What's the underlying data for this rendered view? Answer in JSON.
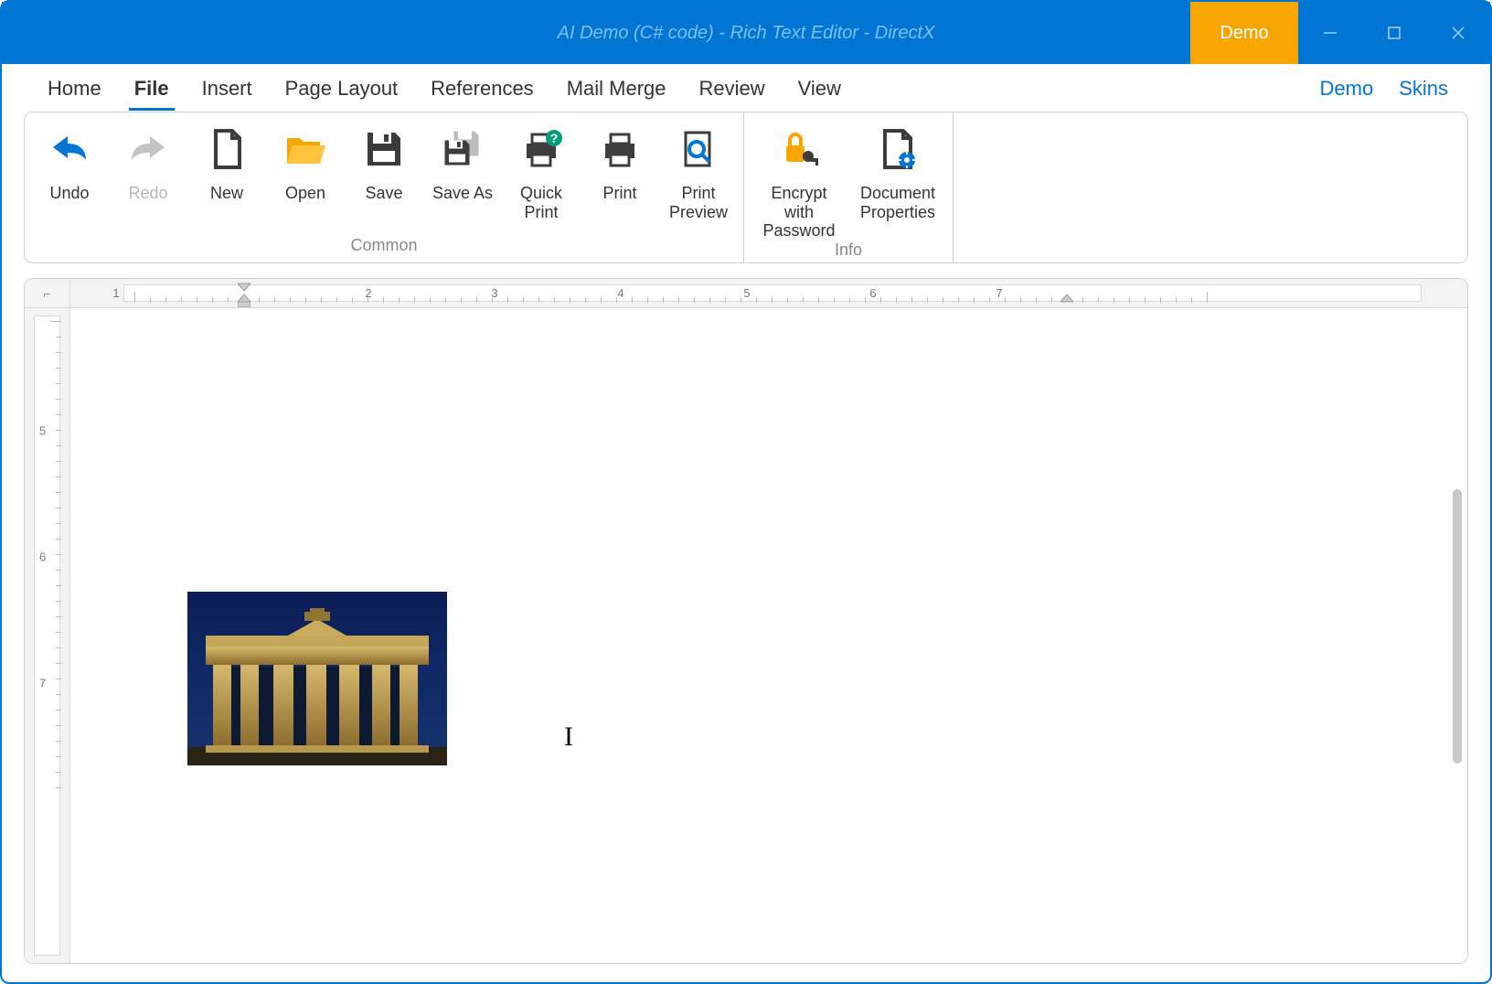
{
  "window": {
    "title": "AI Demo (C# code) - Rich Text Editor - DirectX",
    "demo_badge": "Demo"
  },
  "menu": {
    "tabs": [
      {
        "label": "Home",
        "active": false
      },
      {
        "label": "File",
        "active": true
      },
      {
        "label": "Insert",
        "active": false
      },
      {
        "label": "Page Layout",
        "active": false
      },
      {
        "label": "References",
        "active": false
      },
      {
        "label": "Mail Merge",
        "active": false
      },
      {
        "label": "Review",
        "active": false
      },
      {
        "label": "View",
        "active": false
      }
    ],
    "links": [
      {
        "label": "Demo"
      },
      {
        "label": "Skins"
      }
    ]
  },
  "ribbon": {
    "groups": [
      {
        "label": "Common",
        "items": [
          {
            "id": "undo",
            "label": "Undo",
            "icon": "undo-icon",
            "enabled": true
          },
          {
            "id": "redo",
            "label": "Redo",
            "icon": "redo-icon",
            "enabled": false
          },
          {
            "id": "new",
            "label": "New",
            "icon": "new-file-icon",
            "enabled": true
          },
          {
            "id": "open",
            "label": "Open",
            "icon": "open-folder-icon",
            "enabled": true
          },
          {
            "id": "save",
            "label": "Save",
            "icon": "save-icon",
            "enabled": true
          },
          {
            "id": "save-as",
            "label": "Save As",
            "icon": "save-as-icon",
            "enabled": true
          },
          {
            "id": "quick-print",
            "label": "Quick Print",
            "icon": "quick-print-icon",
            "enabled": true
          },
          {
            "id": "print",
            "label": "Print",
            "icon": "print-icon",
            "enabled": true
          },
          {
            "id": "print-preview",
            "label": "Print Preview",
            "icon": "print-preview-icon",
            "enabled": true
          }
        ]
      },
      {
        "label": "Info",
        "items": [
          {
            "id": "encrypt",
            "label": "Encrypt with Password",
            "icon": "lock-key-icon",
            "enabled": true
          },
          {
            "id": "docprops",
            "label": "Document Properties",
            "icon": "document-properties-icon",
            "enabled": true
          }
        ]
      }
    ]
  },
  "ruler": {
    "horizontal_numbers": [
      "1",
      "2",
      "3",
      "4",
      "5",
      "6",
      "7"
    ],
    "vertical_numbers": [
      "5",
      "6",
      "7"
    ]
  },
  "document": {
    "embedded_image_description": "Photo of the Brandenburg Gate at night, illuminated, with dark blue sky"
  }
}
